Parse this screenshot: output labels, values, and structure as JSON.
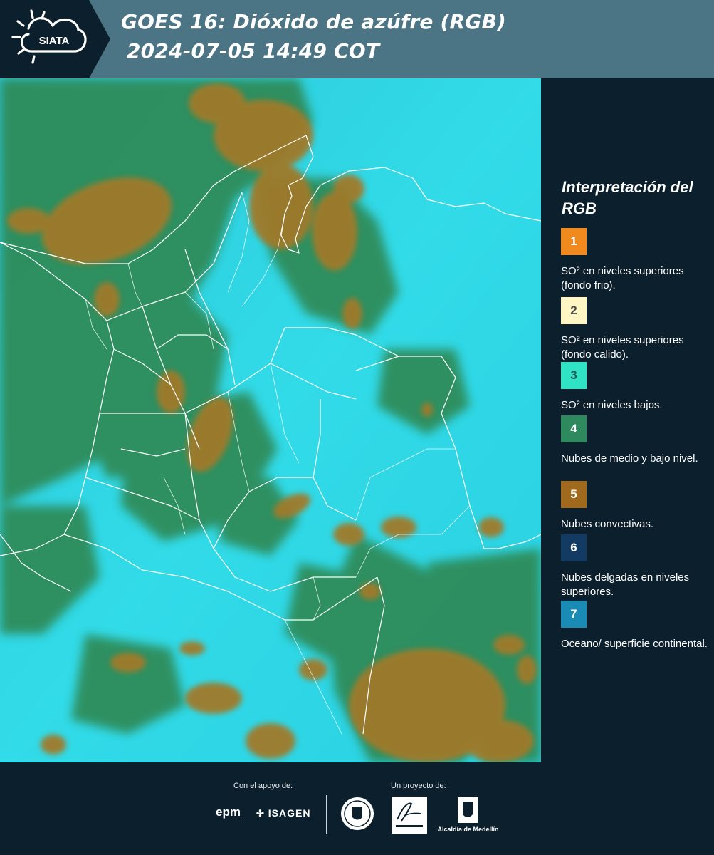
{
  "header": {
    "logo_text": "SIATA",
    "title_line1": "GOES 16: Dióxido de azúfre (RGB)",
    "title_line2": "2024-07-05 14:49 COT",
    "colors": {
      "bar": "#4b7585",
      "logo_bg": "#0c1f2c"
    }
  },
  "map": {
    "icon": "satellite-rgb-imagery",
    "colors": {
      "surface": "#2bd6e6",
      "low_clouds": "#2e8a55",
      "convective": "#a2782a",
      "borders": "#ffffff"
    }
  },
  "legend": {
    "title": "Interpretación del RGB",
    "items": [
      {
        "number": "1",
        "label": "SO² en niveles superiores (fondo frio).",
        "color": "#f08a1f",
        "number_color": "#ffffff"
      },
      {
        "number": "2",
        "label": "SO² en niveles superiores (fondo calido).",
        "color": "#fff6c3",
        "number_color": "#4a4a4a"
      },
      {
        "number": "3",
        "label": "SO² en niveles bajos.",
        "color": "#2fe3c4",
        "number_color": "#2a5b5b"
      },
      {
        "number": "4",
        "label": "Nubes de medio y bajo nivel.",
        "color": "#2e8a5e",
        "number_color": "#ffffff"
      },
      {
        "number": "5",
        "label": "Nubes convectivas.",
        "color": "#a1691e",
        "number_color": "#ffffff"
      },
      {
        "number": "6",
        "label": "Nubes delgadas en niveles superiores.",
        "color": "#133a63",
        "number_color": "#ffffff"
      },
      {
        "number": "7",
        "label": "Oceano/ superficie continental.",
        "color": "#1a8bb5",
        "number_color": "#ffffff"
      }
    ]
  },
  "footer": {
    "support_label": "Con el apoyo de:",
    "project_label": "Un proyecto de:",
    "sponsors": [
      "epm",
      "ISAGEN"
    ],
    "partners": [
      "Alcaldía de Medellín"
    ]
  }
}
